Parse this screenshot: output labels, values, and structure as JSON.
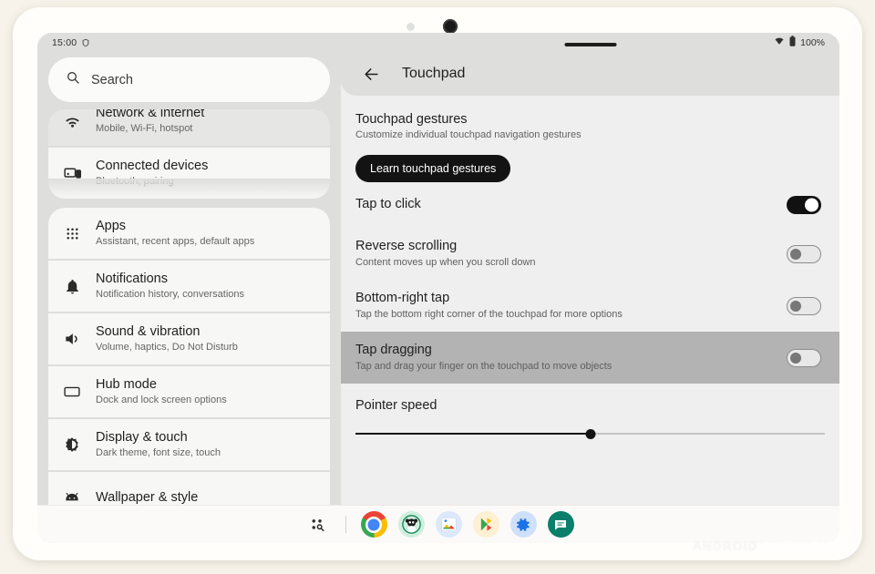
{
  "device": {
    "frame_color": "#fffefb",
    "page_background": "#f7f3ea",
    "sensor_icon": "proximity-sensor-dot",
    "camera_icon": "front-camera-dot"
  },
  "status_bar": {
    "time": "15:00",
    "left_icon": "brave-shield-icon",
    "wifi_icon": "wifi-icon",
    "battery_icon": "battery-full-icon",
    "battery_level": "100%"
  },
  "sidebar": {
    "search": {
      "icon": "search-icon",
      "placeholder": "Search",
      "value": "Search"
    },
    "groups": [
      {
        "items": [
          {
            "icon": "wifi-icon",
            "title": "Network & internet",
            "subtitle": "Mobile, Wi-Fi, hotspot",
            "state": "scrolled-under"
          },
          {
            "icon": "connected-devices-icon",
            "title": "Connected devices",
            "subtitle": "Bluetooth, pairing",
            "state": "normal"
          }
        ]
      },
      {
        "items": [
          {
            "icon": "apps-grid-icon",
            "title": "Apps",
            "subtitle": "Assistant, recent apps, default apps",
            "state": "normal"
          },
          {
            "icon": "bell-icon",
            "title": "Notifications",
            "subtitle": "Notification history, conversations",
            "state": "normal"
          },
          {
            "icon": "volume-icon",
            "title": "Sound & vibration",
            "subtitle": "Volume, haptics, Do Not Disturb",
            "state": "normal"
          },
          {
            "icon": "monitor-icon",
            "title": "Hub mode",
            "subtitle": "Dock and lock screen options",
            "state": "normal"
          },
          {
            "icon": "brightness-icon",
            "title": "Display & touch",
            "subtitle": "Dark theme, font size, touch",
            "state": "normal"
          },
          {
            "icon": "android-head-icon",
            "title": "Wallpaper & style",
            "subtitle": "",
            "state": "clipped"
          }
        ]
      }
    ]
  },
  "detail": {
    "back_icon": "back-arrow-icon",
    "title": "Touchpad",
    "grab_handle": "window-grab-handle",
    "gestures": {
      "title": "Touchpad gestures",
      "subtitle": "Customize individual touchpad navigation gestures",
      "button_label": "Learn touchpad gestures"
    },
    "rows": [
      {
        "title": "Tap to click",
        "subtitle": "",
        "toggle": "on",
        "highlighted": false
      },
      {
        "title": "Reverse scrolling",
        "subtitle": "Content moves up when you scroll down",
        "toggle": "off",
        "highlighted": false
      },
      {
        "title": "Bottom-right tap",
        "subtitle": "Tap the bottom right corner of the touchpad for more options",
        "toggle": "off",
        "highlighted": false
      },
      {
        "title": "Tap dragging",
        "subtitle": "Tap and drag your finger on the touchpad to move objects",
        "toggle": "off",
        "highlighted": true
      }
    ],
    "slider": {
      "label": "Pointer speed",
      "value_percent": 50
    }
  },
  "taskbar": {
    "launcher_icon": "all-apps-search-icon",
    "apps": [
      {
        "icon": "chrome-icon",
        "label": "Chrome"
      },
      {
        "icon": "panda-app-icon",
        "label": "Panda app"
      },
      {
        "icon": "google-photos-icon",
        "label": "Photos"
      },
      {
        "icon": "play-store-icon",
        "label": "Play Store"
      },
      {
        "icon": "settings-gear-icon",
        "label": "Settings"
      },
      {
        "icon": "messages-icon",
        "label": "Messages"
      }
    ]
  },
  "watermark": {
    "part1": "ANDROID",
    "part2": "AUTHORITY"
  }
}
